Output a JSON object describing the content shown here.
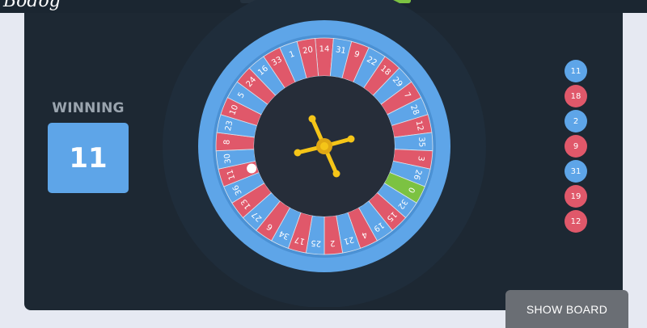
{
  "header": {
    "logo_text": "Bodog"
  },
  "winning": {
    "label": "WINNING",
    "number": "11",
    "color": "#5ea5e8"
  },
  "wheel": {
    "numbers": [
      "14",
      "31",
      "9",
      "22",
      "18",
      "29",
      "7",
      "28",
      "12",
      "35",
      "3",
      "26",
      "0",
      "32",
      "15",
      "19",
      "4",
      "21",
      "2",
      "25",
      "17",
      "34",
      "6",
      "27",
      "13",
      "36",
      "11",
      "30",
      "8",
      "23",
      "10",
      "5",
      "24",
      "16",
      "33",
      "1",
      "20"
    ],
    "colors": {
      "red": "#e0586a",
      "blue": "#5ea5e8",
      "green": "#7cc242",
      "hub": "#262d39",
      "turret": "#f5c518"
    },
    "ball_number": "11"
  },
  "history": [
    {
      "number": "11",
      "color": "blue"
    },
    {
      "number": "18",
      "color": "red"
    },
    {
      "number": "2",
      "color": "blue"
    },
    {
      "number": "9",
      "color": "red"
    },
    {
      "number": "31",
      "color": "blue"
    },
    {
      "number": "19",
      "color": "red"
    },
    {
      "number": "12",
      "color": "red"
    }
  ],
  "actions": {
    "show_board_label": "SHOW BOARD"
  }
}
